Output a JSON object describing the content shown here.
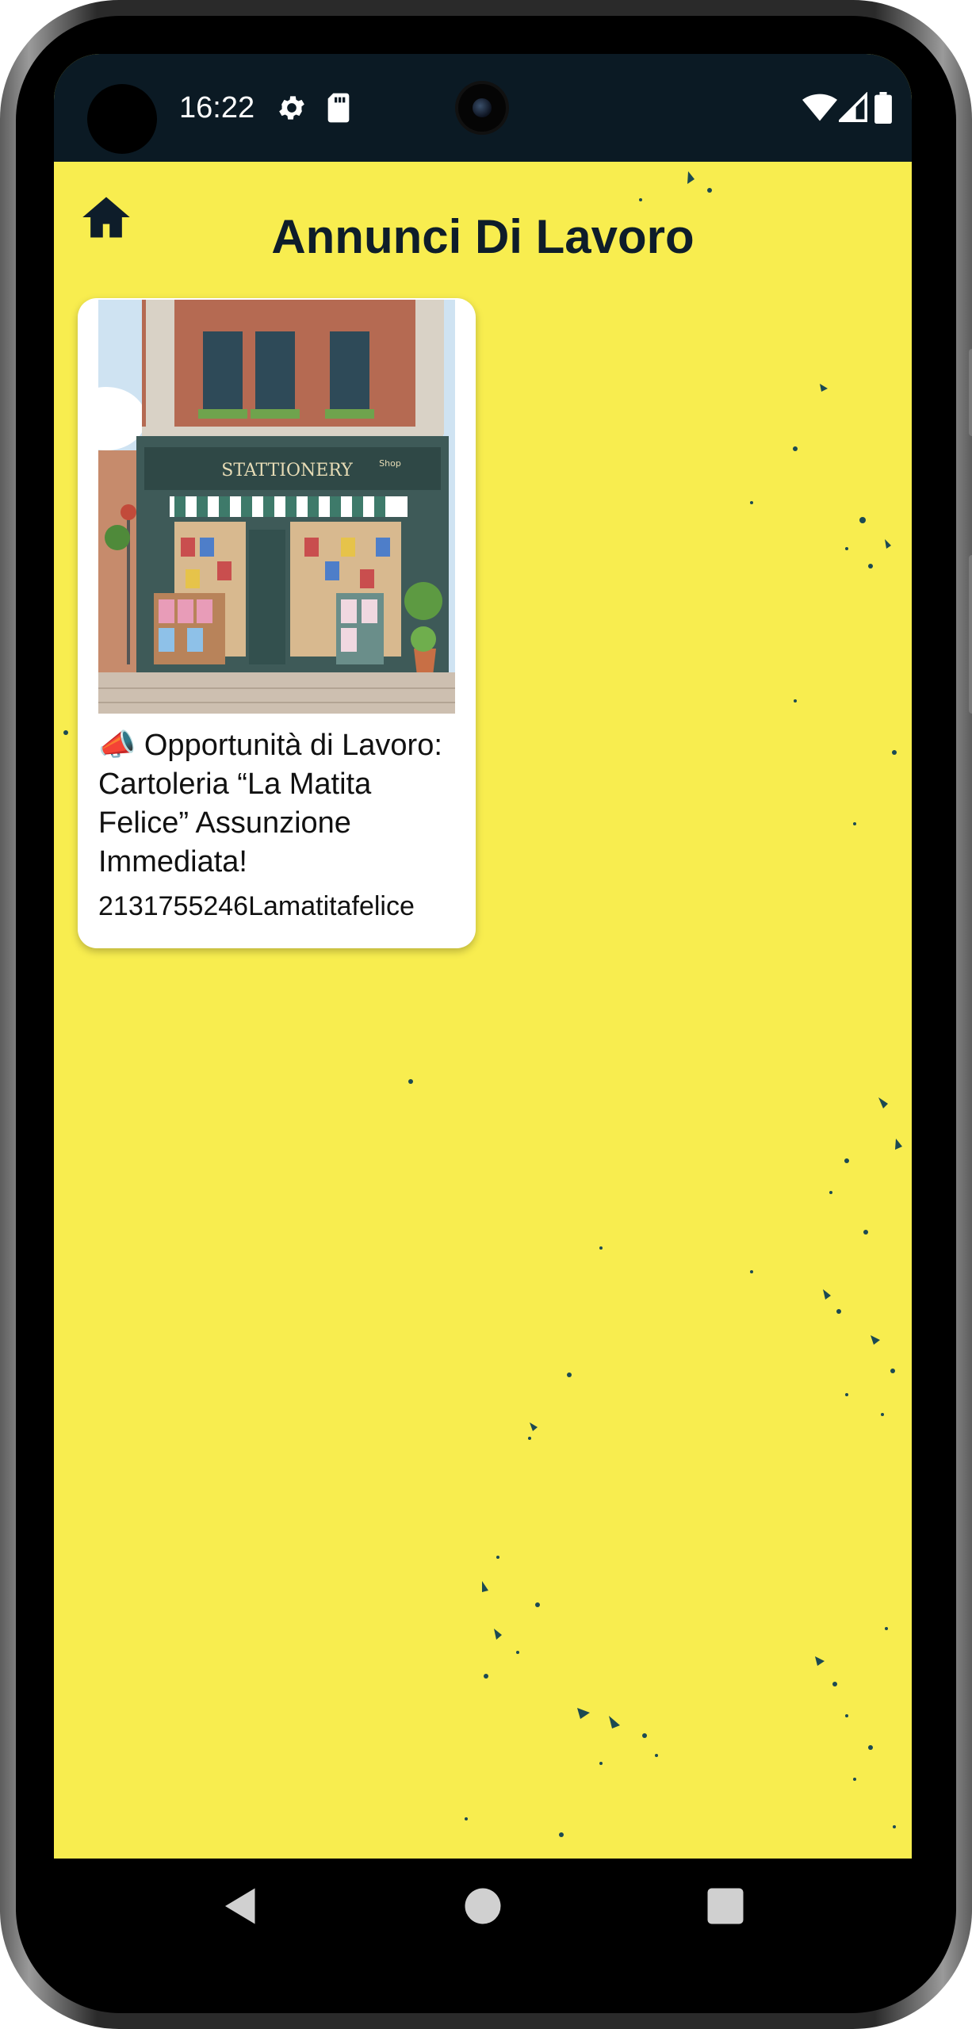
{
  "status_bar": {
    "time": "16:22",
    "icons": [
      "settings-gear-icon",
      "sd-card-icon",
      "wifi-icon",
      "cellular-signal-icon",
      "battery-icon"
    ]
  },
  "header": {
    "title": "Annunci Di Lavoro",
    "home_icon": "home-icon"
  },
  "listings": [
    {
      "image_sign": "STATTIONERY",
      "image_side_sign": "Shop",
      "title": "📣 Opportunità di Lavoro: Cartoleria “La Matita Felice” Assunzione Immediata!",
      "subtitle": "2131755246Lamatitafelice"
    }
  ],
  "nav": {
    "icons": [
      "back-icon",
      "home-nav-icon",
      "recents-icon"
    ]
  },
  "colors": {
    "app_background": "#f8ed4f",
    "status_bar": "#0b1a24",
    "title_text": "#0e1d2a",
    "card_background": "#ffffff"
  }
}
